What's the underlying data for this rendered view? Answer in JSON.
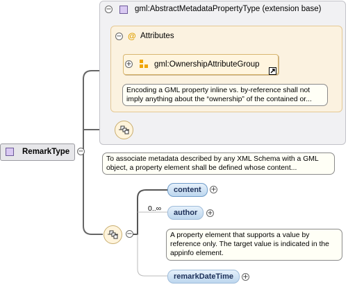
{
  "extension": {
    "title": "gml:AbstractMetadataPropertyType (extension base)",
    "toggle": "−"
  },
  "attributes": {
    "label": "Attributes",
    "icon": "@",
    "toggle": "−"
  },
  "attribute_group": {
    "name": "gml:OwnershipAttributeGroup",
    "toggle": "+",
    "tooltip": "Encoding a GML property inline vs. by-reference shall not imply anything about the “ownership” of the contained or..."
  },
  "root": {
    "name": "RemarkType",
    "toggle": "−",
    "tooltip": "To associate metadata described by any XML Schema with a GML object, a property element shall be defined whose content..."
  },
  "sequence": {
    "toggle": "−",
    "items": [
      {
        "name": "content",
        "toggle": "+",
        "occurrence": ""
      },
      {
        "name": "author",
        "toggle": "+",
        "occurrence": "0..∞",
        "tooltip": "A property element that supports a value by reference only. The target value is indicated in the appinfo element."
      },
      {
        "name": "remarkDateTime",
        "toggle": "+",
        "occurrence": ""
      }
    ]
  },
  "colors": {
    "element_fill": "#bcd6ee",
    "attribute_panel": "#fbf2e0",
    "extension_panel": "#f1f1f3"
  }
}
